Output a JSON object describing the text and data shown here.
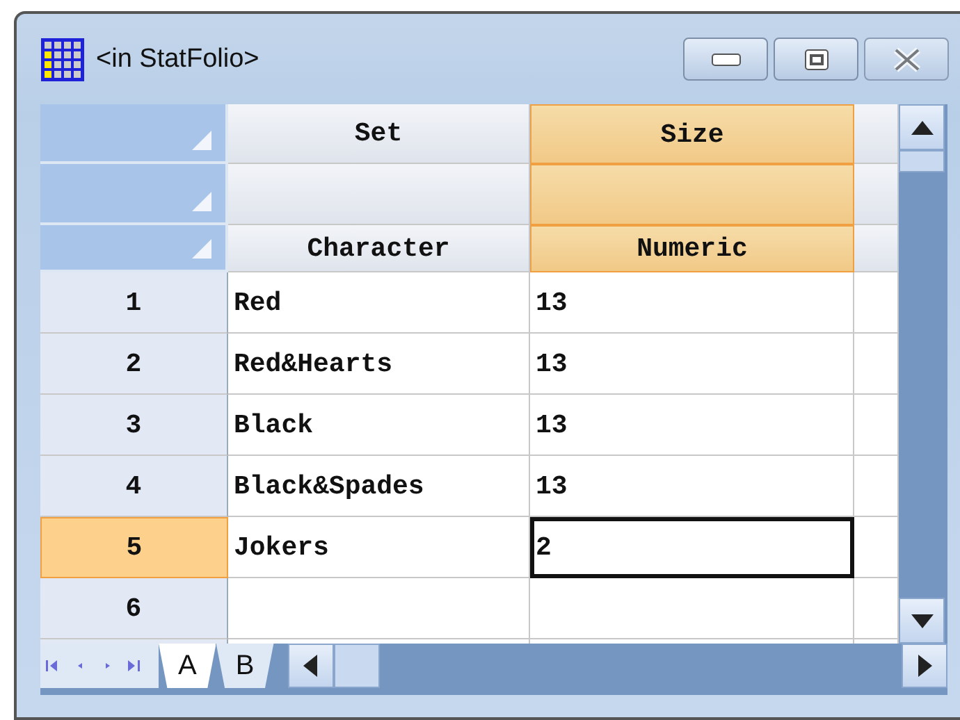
{
  "window": {
    "title": "<in StatFolio>"
  },
  "columns": [
    {
      "name": "Set",
      "type": "Character",
      "selected": false
    },
    {
      "name": "Size",
      "type": "Numeric",
      "selected": true
    }
  ],
  "rows": [
    {
      "number": "1",
      "selected": false,
      "cells": [
        {
          "value": "Red",
          "focused": false
        },
        {
          "value": "13",
          "focused": false
        }
      ]
    },
    {
      "number": "2",
      "selected": false,
      "cells": [
        {
          "value": "Red&Hearts",
          "focused": false
        },
        {
          "value": "13",
          "focused": false
        }
      ]
    },
    {
      "number": "3",
      "selected": false,
      "cells": [
        {
          "value": "Black",
          "focused": false
        },
        {
          "value": "13",
          "focused": false
        }
      ]
    },
    {
      "number": "4",
      "selected": false,
      "cells": [
        {
          "value": "Black&Spades",
          "focused": false
        },
        {
          "value": "13",
          "focused": false
        }
      ]
    },
    {
      "number": "5",
      "selected": true,
      "cells": [
        {
          "value": "Jokers",
          "focused": false
        },
        {
          "value": "2",
          "focused": true
        }
      ]
    },
    {
      "number": "6",
      "selected": false
    }
  ],
  "sheet_tabs": [
    {
      "label": "A",
      "selected": true
    },
    {
      "label": "B",
      "selected": false
    }
  ]
}
